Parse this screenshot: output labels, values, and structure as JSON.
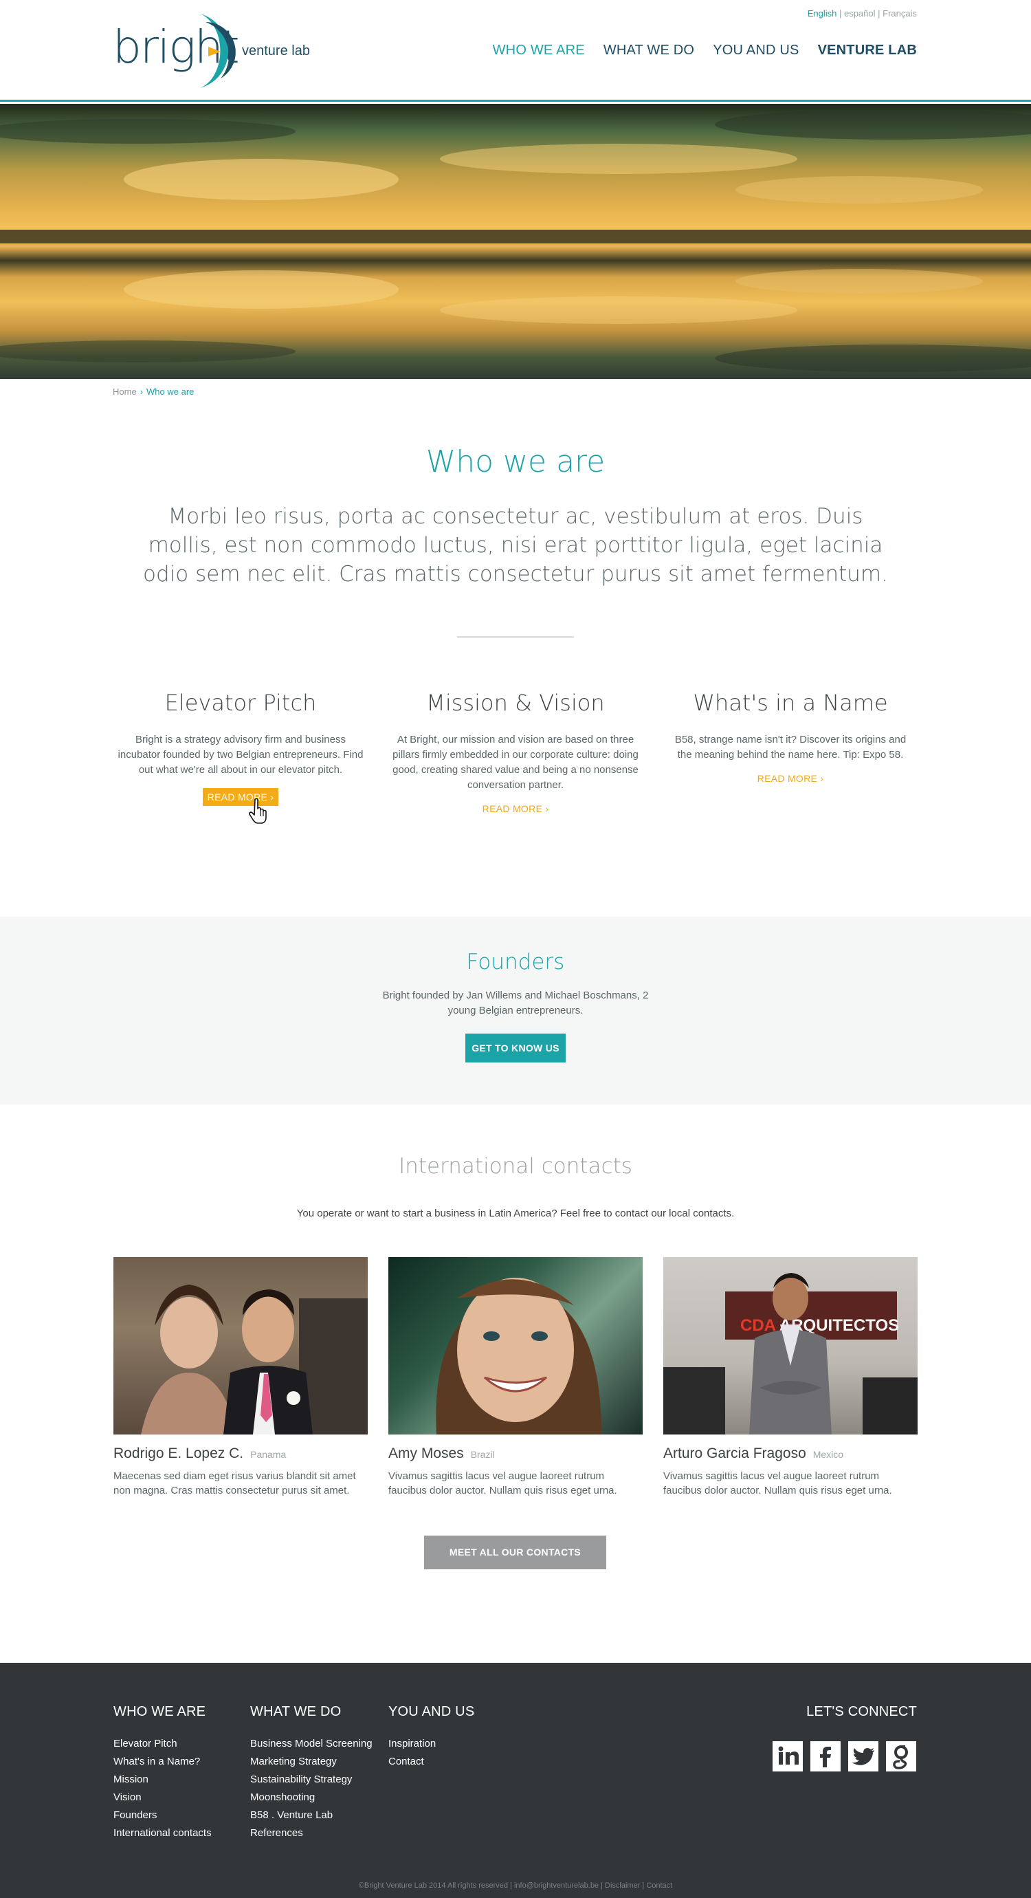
{
  "header": {
    "logo_word": "bright",
    "logo_sub": "venture lab",
    "languages": [
      "English",
      "español",
      "Français"
    ],
    "nav": [
      {
        "label": "WHO WE ARE",
        "active": true
      },
      {
        "label": "WHAT WE DO",
        "active": false
      },
      {
        "label": "YOU AND US",
        "active": false
      },
      {
        "label": "VENTURE LAB",
        "active": false
      }
    ]
  },
  "breadcrumb": {
    "home": "Home",
    "sep": "›",
    "current": "Who we are"
  },
  "who": {
    "title": "Who we are",
    "lead": "Morbi leo risus, porta ac consectetur ac, vestibulum at eros. Duis mollis, est non commodo luctus, nisi erat porttitor ligula, eget lacinia odio sem nec elit. Cras mattis consectetur purus sit amet fermentum."
  },
  "features": [
    {
      "title": "Elevator Pitch",
      "text": "Bright is a strategy advisory firm and business incubator founded by two Belgian entrepreneurs. Find out what we're all about in our elevator pitch.",
      "more": "READ MORE ›"
    },
    {
      "title": "Mission & Vision",
      "text": "At Bright, our mission and vision are based on three pillars firmly embedded in our corporate culture: doing good, creating shared value and being a no nonsense conversation partner.",
      "more": "READ MORE ›"
    },
    {
      "title": "What's in a Name",
      "text": "B58, strange name isn't it? Discover its origins and the meaning behind the name here. Tip: Expo 58.",
      "more": "READ MORE ›"
    }
  ],
  "founders": {
    "title": "Founders",
    "text": "Bright founded by Jan Willems and Michael Boschmans, 2 young Belgian entrepreneurs.",
    "button": "GET TO KNOW US"
  },
  "international": {
    "title": "International contacts",
    "text": "You operate or want to start a business in Latin America? Feel free to contact our local contacts.",
    "contacts": [
      {
        "name": "Rodrigo E. Lopez C.",
        "country": "Panama",
        "text": "Maecenas sed diam eget risus varius blandit sit amet non magna. Cras mattis consectetur purus sit amet."
      },
      {
        "name": "Amy Moses",
        "country": "Brazil",
        "text": "Vivamus sagittis lacus vel augue laoreet rutrum faucibus dolor auctor. Nullam quis risus eget urna."
      },
      {
        "name": "Arturo Garcia Fragoso",
        "country": "Mexico",
        "text": "Vivamus sagittis lacus vel augue laoreet rutrum faucibus dolor auctor. Nullam quis risus eget urna."
      }
    ],
    "photo_sign": "CDA ARQUITECTOS",
    "button": "MEET ALL OUR CONTACTS"
  },
  "footer": {
    "columns": [
      {
        "title": "WHO WE ARE",
        "links": [
          "Elevator Pitch",
          "What's in a Name?",
          "Mission",
          "Vision",
          "Founders",
          "International contacts"
        ]
      },
      {
        "title": "WHAT WE DO",
        "links": [
          "Business Model Screening",
          "Marketing Strategy",
          "Sustainability Strategy",
          "Moonshooting",
          "B58 . Venture Lab",
          "References"
        ]
      },
      {
        "title": "YOU AND US",
        "links": [
          "Inspiration",
          "Contact"
        ]
      }
    ],
    "connect_title": "LET'S CONNECT",
    "social": [
      "linkedin-icon",
      "facebook-icon",
      "twitter-icon",
      "google-icon"
    ],
    "copyright": "©Bright Venture Lab 2014 All rights reserved | info@brightventurelab.be | Disclaimer | Contact"
  },
  "colors": {
    "teal": "#1ba3a8",
    "navy": "#1f4d63",
    "orange": "#f4ac16",
    "footer": "#333638"
  }
}
